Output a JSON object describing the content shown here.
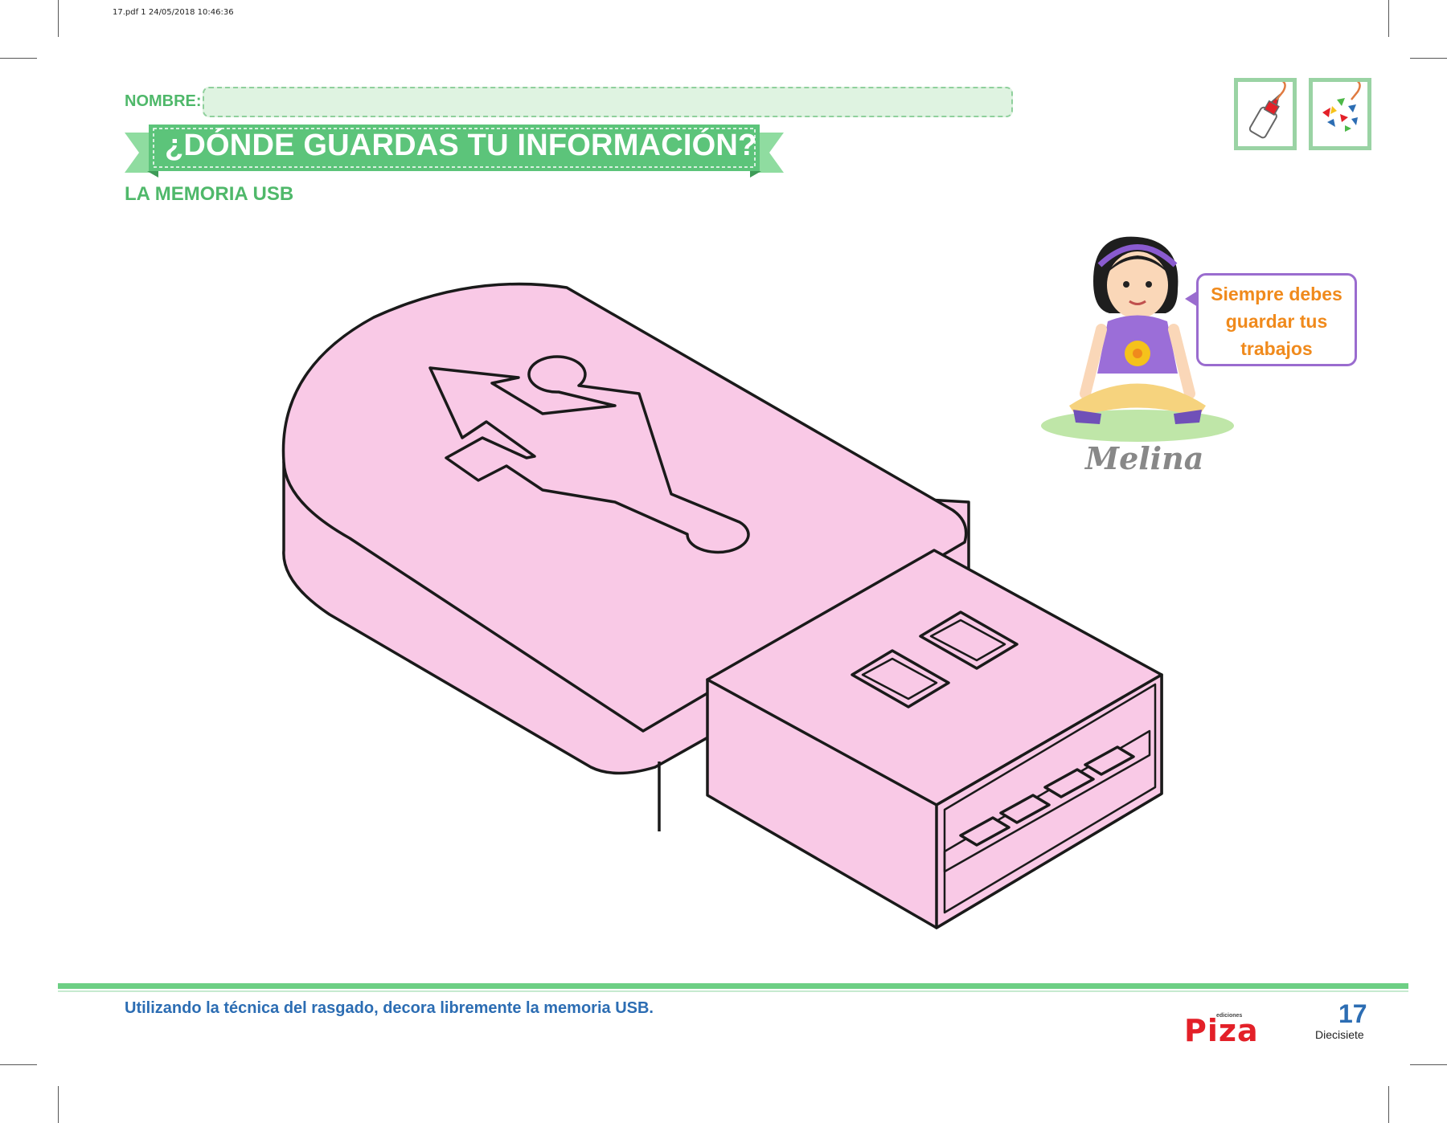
{
  "print_info": "17.pdf   1   24/05/2018   10:46:36",
  "header": {
    "name_label": "NOMBRE:",
    "title": "¿DÓNDE GUARDAS TU INFORMACIÓN?",
    "subtitle": "LA MEMORIA USB"
  },
  "icons": [
    "glue-bottle-icon",
    "paper-pieces-icon"
  ],
  "character": {
    "speech": [
      "Siempre debes",
      "guardar tus",
      "trabajos"
    ],
    "name": "Melina"
  },
  "footer": {
    "instruction": "Utilizando la técnica del rasgado, decora libremente la memoria USB.",
    "publisher_small": "ediciones",
    "publisher": "Piza",
    "page_number": "17",
    "page_word": "Diecisiete"
  },
  "colors": {
    "usb_fill": "#f9c9e6",
    "accent_green": "#4fb86a",
    "banner_green": "#5cc47a",
    "instruction_blue": "#2c6db3",
    "speech_orange": "#f08a1c"
  }
}
